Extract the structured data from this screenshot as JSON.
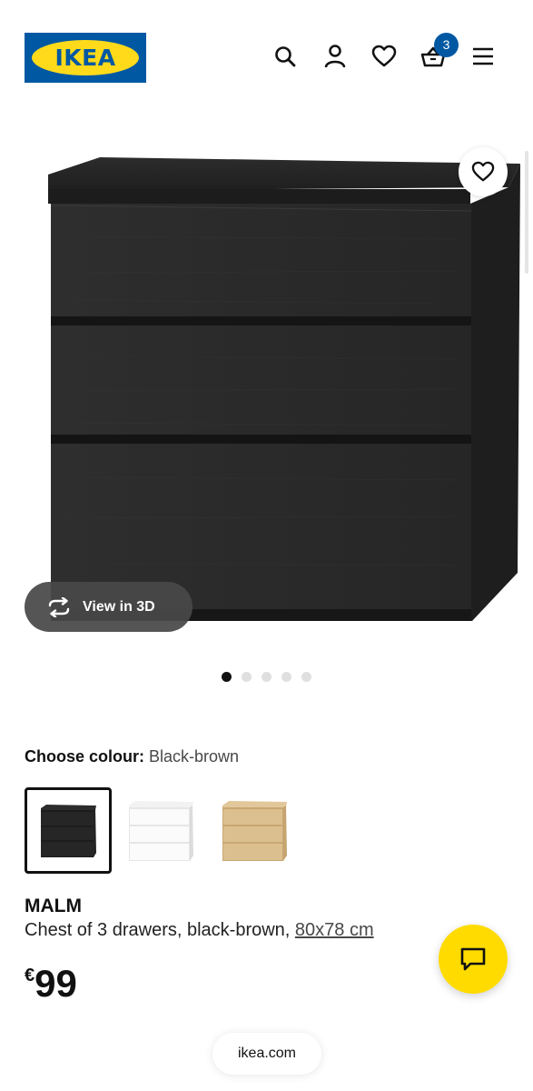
{
  "header": {
    "logo_text": "IKEA",
    "cart_count": "3",
    "icons": [
      "search-icon",
      "user-icon",
      "heart-icon",
      "cart-icon",
      "menu-icon"
    ]
  },
  "gallery": {
    "image": "dresser-black-brown",
    "view_3d_label": "View in 3D",
    "dots_total": 5,
    "dots_active_index": 0
  },
  "colour": {
    "label": "Choose colour:",
    "selected": "Black-brown",
    "swatches": [
      "black-brown",
      "white",
      "oak-effect"
    ]
  },
  "product": {
    "name": "MALM",
    "description": "Chest of 3 drawers, black-brown, ",
    "size_link": "80x78 cm",
    "currency": "€",
    "price": "99"
  },
  "footer": {
    "url": "ikea.com"
  },
  "colors": {
    "ikea_blue": "#0058a3",
    "ikea_yellow": "#ffda1a",
    "chat_yellow": "#ffdb00"
  }
}
